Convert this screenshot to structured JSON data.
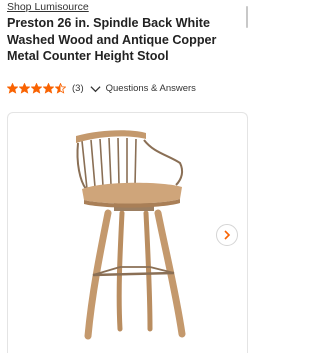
{
  "store": {
    "link_text": "Shop Lumisource"
  },
  "product": {
    "title": "Preston 26 in. Spindle Back White Washed Wood and Antique Copper Metal Counter Height Stool"
  },
  "rating": {
    "value": 4.5,
    "max": 5,
    "count_text": "(3)",
    "star_color": "#f96302",
    "qa_label": "Questions & Answers"
  },
  "icons": {
    "rating": "star-icon",
    "expand": "chevron-down-icon",
    "next": "chevron-right-icon"
  },
  "colors": {
    "accent": "#f96302",
    "text": "#222222",
    "wood": "#c4996d",
    "metal": "#8a6f55"
  }
}
